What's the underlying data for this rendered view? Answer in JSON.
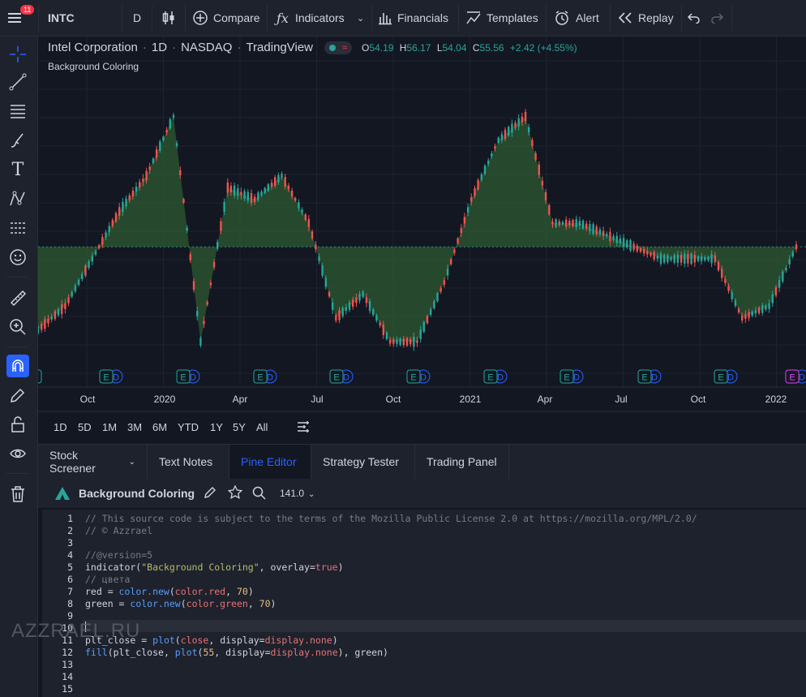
{
  "topbar": {
    "notification_count": "11",
    "symbol": "INTC",
    "interval": "D",
    "compare": "Compare",
    "indicators": "Indicators",
    "financials": "Financials",
    "templates": "Templates",
    "alert": "Alert",
    "replay": "Replay"
  },
  "legend": {
    "name": "Intel Corporation",
    "interval": "1D",
    "exchange": "NASDAQ",
    "source": "TradingView",
    "o_label": "O",
    "o": "54.19",
    "h_label": "H",
    "h": "56.17",
    "l_label": "L",
    "l": "54.04",
    "c_label": "C",
    "c": "55.56",
    "change": "+2.42 (+4.55%)",
    "indicator": "Background Coloring"
  },
  "chart_data": {
    "type": "line",
    "baseline": 55,
    "x_ticks": [
      "Oct",
      "2020",
      "Apr",
      "Jul",
      "Oct",
      "2021",
      "Apr",
      "Jul",
      "Oct",
      "2022"
    ],
    "x": [
      "2019-09",
      "2019-10",
      "2019-11",
      "2019-12",
      "2020-01",
      "2020-02",
      "2020-03",
      "2020-04",
      "2020-05",
      "2020-06",
      "2020-07",
      "2020-08",
      "2020-09",
      "2020-10",
      "2020-11",
      "2020-12",
      "2021-01",
      "2021-02",
      "2021-03",
      "2021-04",
      "2021-05",
      "2021-06",
      "2021-07",
      "2021-08",
      "2021-09",
      "2021-10",
      "2021-11",
      "2021-12",
      "2022-01"
    ],
    "values": [
      48,
      50,
      54,
      58,
      61,
      66,
      47,
      60,
      59,
      61,
      57,
      49,
      51,
      47,
      47,
      52,
      59,
      64,
      66,
      57,
      57,
      56,
      55,
      54,
      54,
      54,
      49,
      50,
      55
    ],
    "colors": {
      "above": "#26a69a",
      "below": "#ef5350",
      "fill": "#2e5a32"
    }
  },
  "event_markers": [
    "E",
    "D",
    "E",
    "D",
    "E",
    "D",
    "E",
    "D",
    "E",
    "D",
    "E",
    "D",
    "E",
    "D",
    "E",
    "D",
    "E",
    "D",
    "E",
    "D",
    "E"
  ],
  "timeframes": [
    "1D",
    "5D",
    "1M",
    "3M",
    "6M",
    "YTD",
    "1Y",
    "5Y",
    "All"
  ],
  "bottom_tabs": [
    "Stock Screener",
    "Text Notes",
    "Pine Editor",
    "Strategy Tester",
    "Trading Panel"
  ],
  "editor": {
    "script_name": "Background Coloring",
    "version": "141.0",
    "line_numbers": [
      "1",
      "2",
      "3",
      "4",
      "5",
      "6",
      "7",
      "8",
      "9",
      "10",
      "11",
      "12",
      "13",
      "14",
      "15"
    ]
  },
  "watermark": "AZZRAEL.RU"
}
